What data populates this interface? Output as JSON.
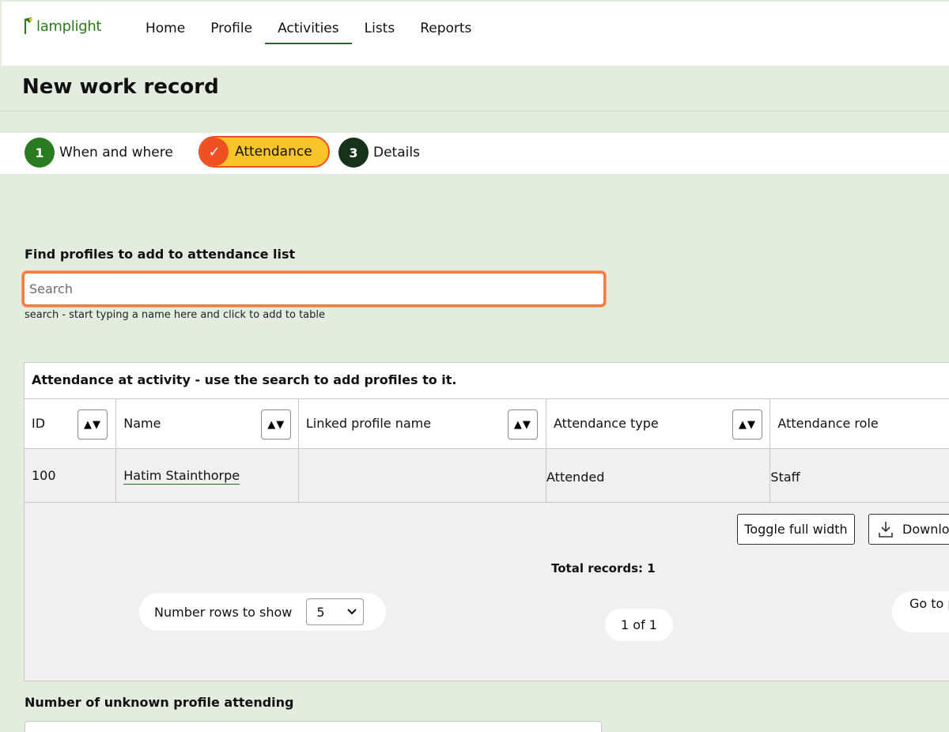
{
  "app": {
    "name": "lamplight"
  },
  "nav": {
    "items": [
      {
        "label": "Home"
      },
      {
        "label": "Profile"
      },
      {
        "label": "Activities",
        "active": true
      },
      {
        "label": "Lists"
      },
      {
        "label": "Reports"
      }
    ]
  },
  "page": {
    "title": "New work record"
  },
  "steps": [
    {
      "number": "1",
      "label": "When and where",
      "state": "complete"
    },
    {
      "number": "✓",
      "label": "Attendance",
      "state": "current"
    },
    {
      "number": "3",
      "label": "Details",
      "state": "upcoming"
    }
  ],
  "search": {
    "label": "Find profiles to add to attendance list",
    "placeholder": "Search",
    "value": "",
    "help": "search - start typing a name here and click to add to table"
  },
  "attendance": {
    "caption": "Attendance at activity - use the search to add profiles to it.",
    "sort_glyph": "▲▼",
    "columns": [
      "ID",
      "Name",
      "Linked profile name",
      "Attendance type",
      "Attendance role"
    ],
    "rows": [
      {
        "id": "100",
        "name": "Hatim Stainthorpe",
        "linked": "",
        "type": "Attended",
        "role": "Staff"
      }
    ],
    "toggle_label": "Toggle full width",
    "download_label": "Download",
    "total_label": "Total records: 1",
    "rows_label": "Number rows to show",
    "rows_value": "5",
    "pager_text": "1 of 1",
    "goto_label": "Go to page"
  },
  "unknown": {
    "label": "Number of unknown profile attending"
  },
  "colors": {
    "brand_green": "#2a7a1f",
    "accent_orange": "#f04f23",
    "accent_yellow": "#f7c52a",
    "page_bg": "#e3ecdf"
  }
}
